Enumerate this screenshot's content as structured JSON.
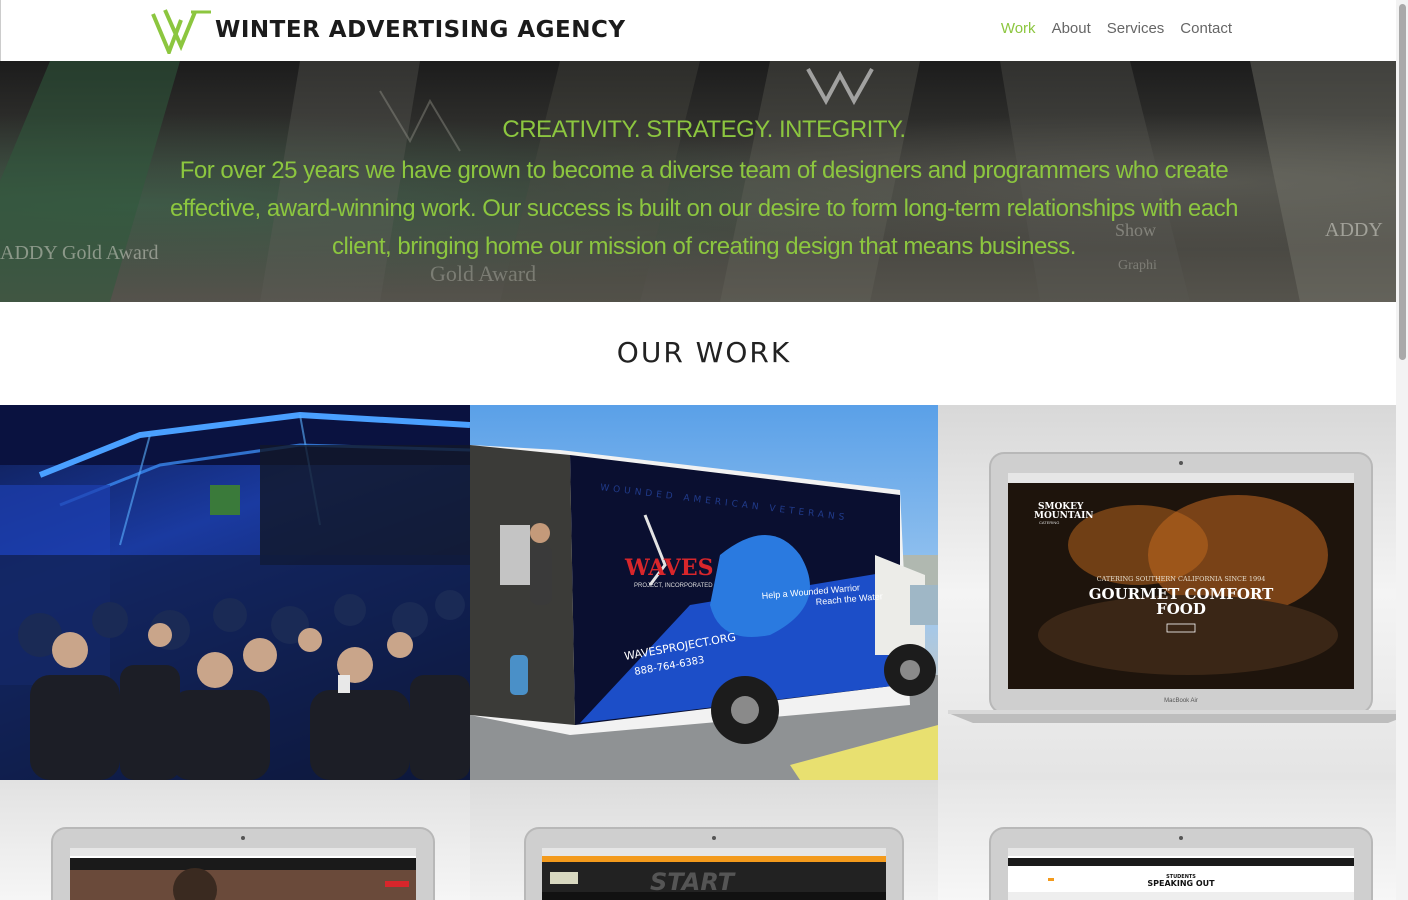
{
  "brand": {
    "name": "WINTER ADVERTISING AGENCY",
    "accent_color": "#8cc63f"
  },
  "nav": {
    "items": [
      {
        "label": "Work",
        "active": true
      },
      {
        "label": "About",
        "active": false
      },
      {
        "label": "Services",
        "active": false
      },
      {
        "label": "Contact",
        "active": false
      }
    ]
  },
  "hero": {
    "tagline": "CREATIVITY. STRATEGY. INTEGRITY.",
    "paragraph": "For over 25 years we have grown to become a diverse team of designers and programmers who create effective, award-winning work. Our success is built on our desire to form long-term relationships with each client, bringing home our mission of creating design that means business.",
    "background_text": [
      "ADDY Gold Award",
      "Gold Award",
      "ADDY",
      "Show",
      "Graphi"
    ]
  },
  "work": {
    "title": "OUR WORK",
    "tiles": [
      {
        "name": "conference-audience"
      },
      {
        "name": "waves-truck",
        "brand": "WAVES",
        "brand_sub": "PROJECT, INCORPORATED",
        "slogan_1": "Help a Wounded Warrior",
        "slogan_2": "Reach the Water",
        "url": "WAVESPROJECT.ORG",
        "phone": "888-764-6383",
        "side_text": "WOUNDED AMERICAN VETERANS"
      },
      {
        "name": "smokey-mountain-laptop",
        "logo_1": "SMOKEY",
        "logo_2": "MOUNTAIN",
        "logo_3": "CATERING",
        "kicker": "CATERING SOUTHERN CALIFORNIA SINCE 1994",
        "headline_1": "GOURMET COMFORT",
        "headline_2": "FOOD",
        "device": "MacBook Air"
      },
      {
        "name": "laptop-mockup-1"
      },
      {
        "name": "laptop-mockup-2",
        "hero_text": "START"
      },
      {
        "name": "laptop-mockup-3",
        "logo_1": "STUDENTS",
        "logo_2": "SPEAKING OUT"
      }
    ]
  }
}
